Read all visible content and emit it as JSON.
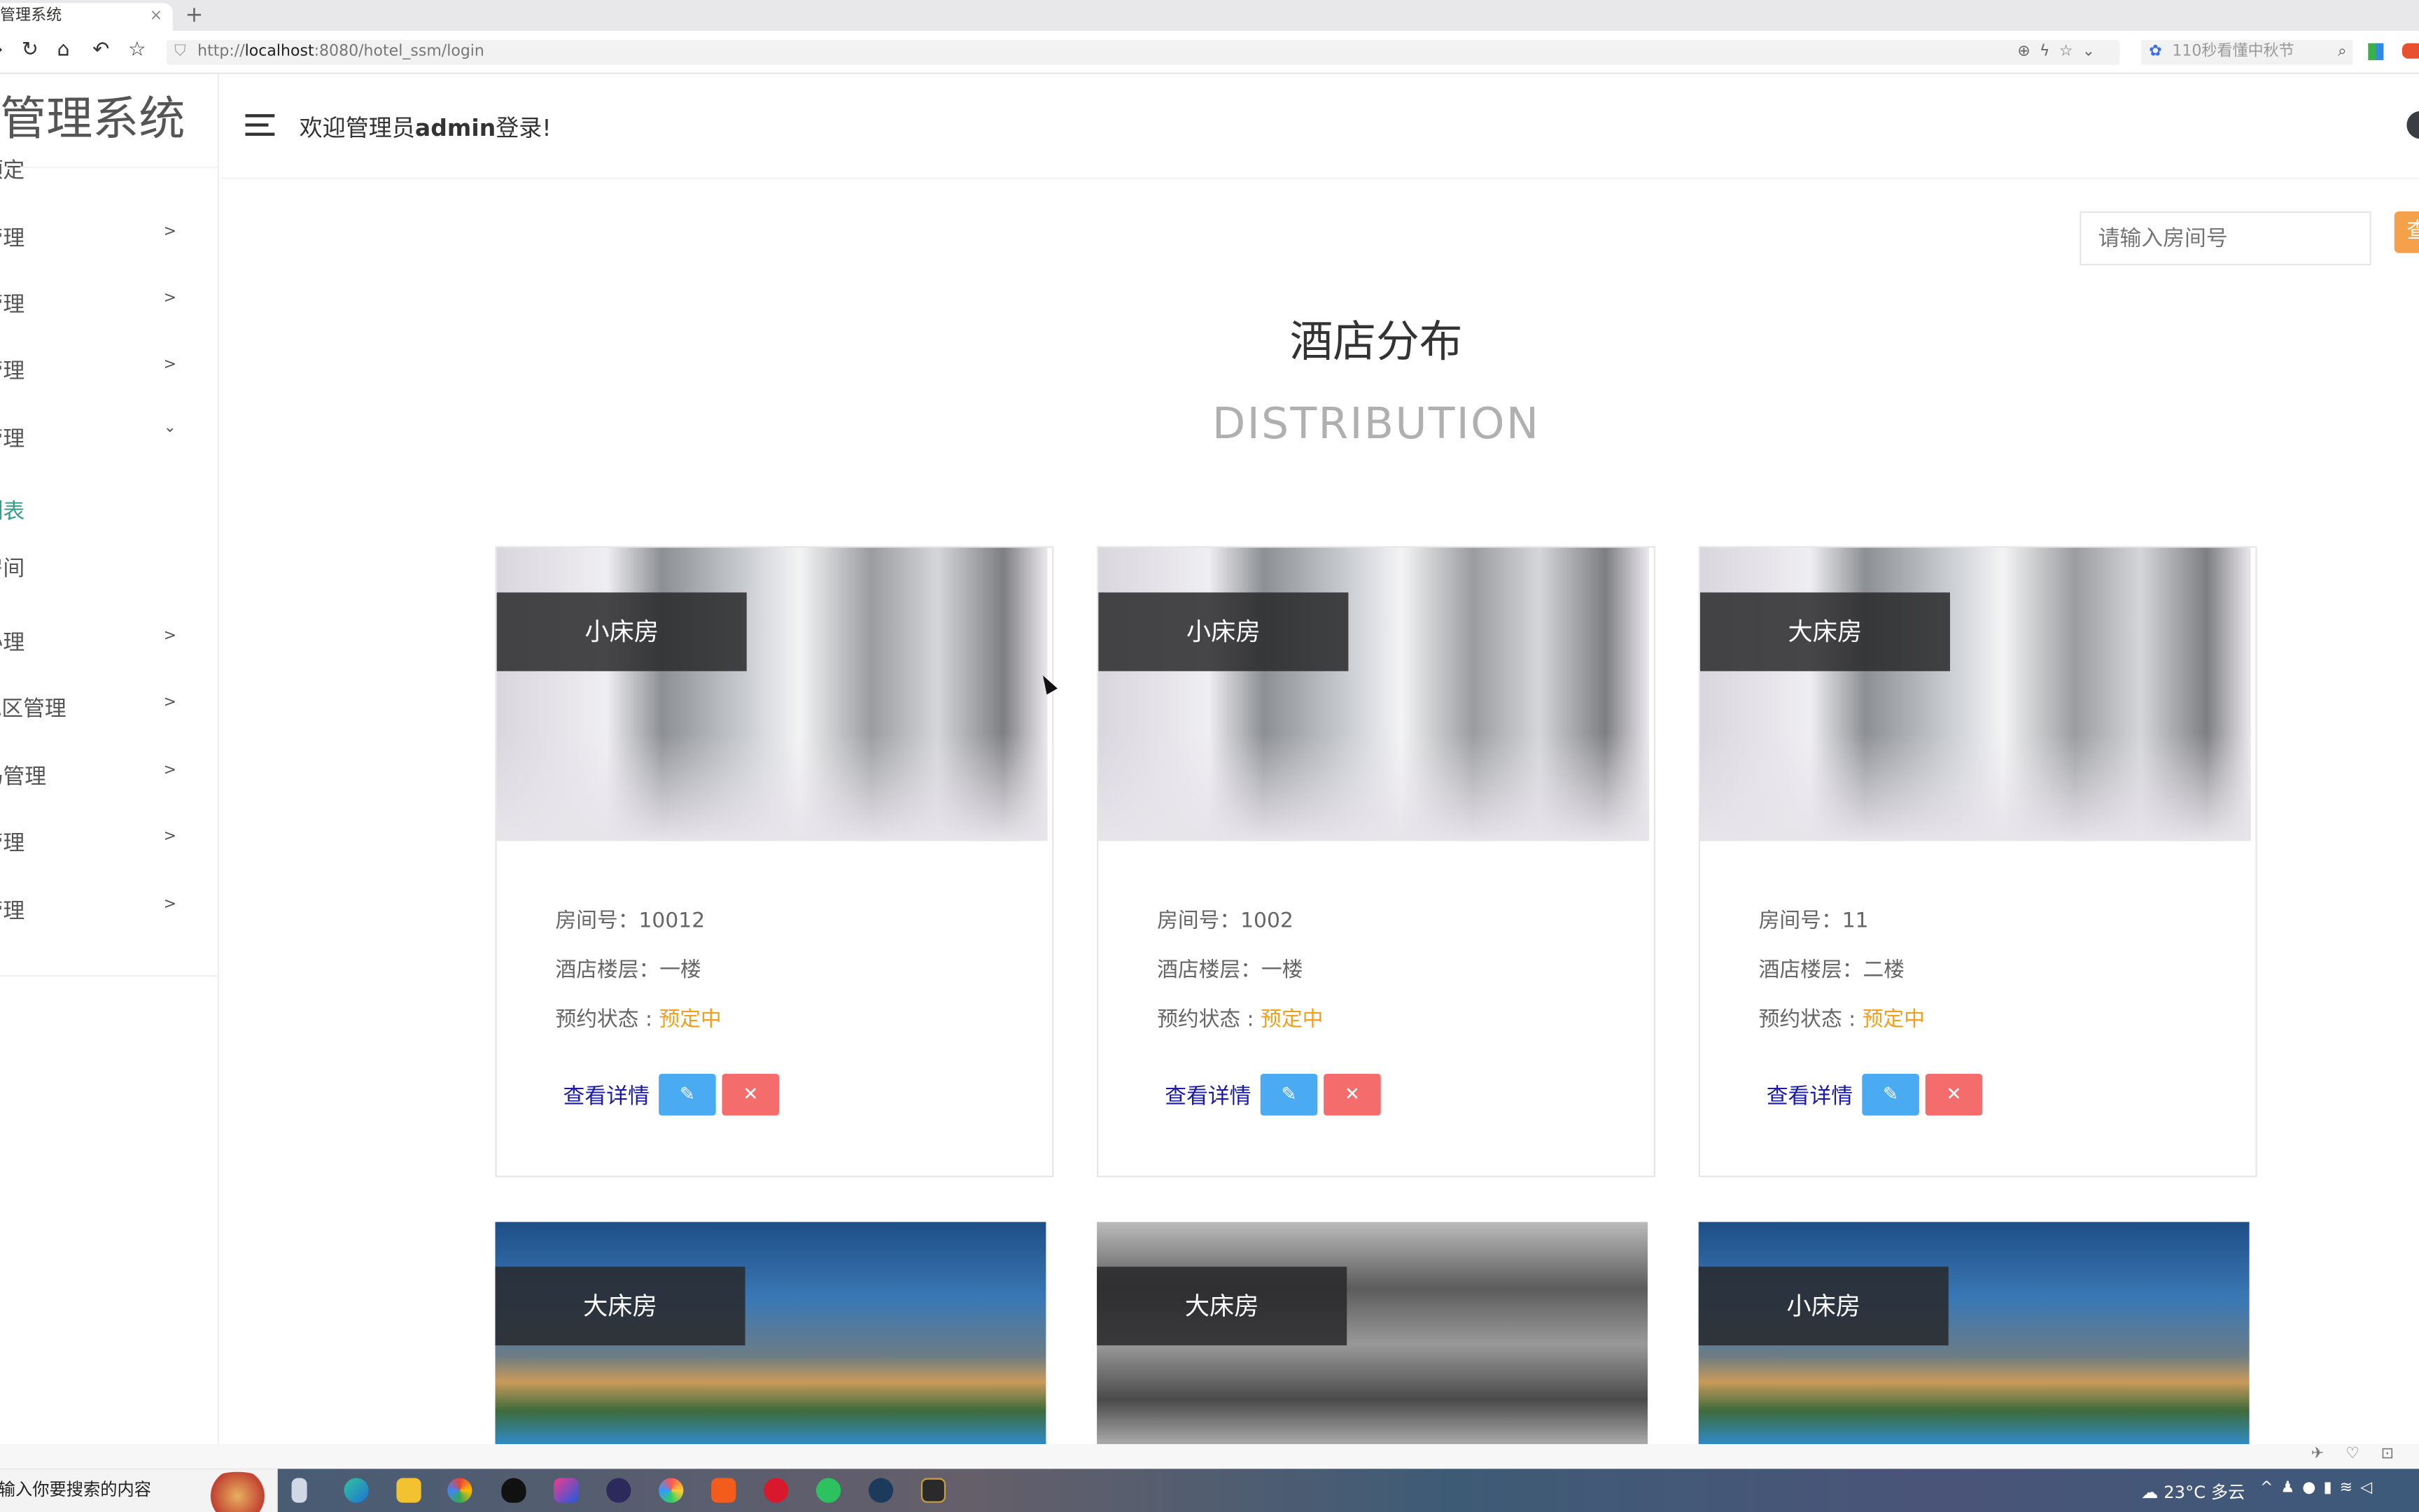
{
  "browser": {
    "tab_title": "管理系统",
    "tab_close": "×",
    "new_tab": "+",
    "url_prefix": "http://",
    "url_host": "localhost",
    "url_rest": ":8080/hotel_ssm/login",
    "search_hint": "110秒看懂中秋节"
  },
  "sidebar": {
    "title": "管理系统",
    "items": [
      {
        "label": "预定",
        "chevron": ""
      },
      {
        "label": "管理",
        "chevron": ">"
      },
      {
        "label": "管理",
        "chevron": ">"
      },
      {
        "label": "管理",
        "chevron": ">"
      },
      {
        "label": "管理",
        "chevron": "⌄"
      },
      {
        "label": "列表",
        "chevron": ""
      },
      {
        "label": "房间",
        "chevron": ""
      },
      {
        "label": "办理",
        "chevron": ">"
      },
      {
        "label": "地区管理",
        "chevron": ">"
      },
      {
        "label": "码管理",
        "chevron": ">"
      },
      {
        "label": "管理",
        "chevron": ">"
      },
      {
        "label": "管理",
        "chevron": ">"
      }
    ]
  },
  "header": {
    "welcome_prefix": "欢迎管理员",
    "welcome_user": "admin",
    "welcome_suffix": "登录!"
  },
  "search": {
    "placeholder": "请输入房间号",
    "button_label": "查"
  },
  "main": {
    "title": "酒店分布",
    "subtitle": "DISTRIBUTION"
  },
  "labels": {
    "room_no": "房间号：",
    "floor": "酒店楼层：",
    "status": "预约状态 : ",
    "detail": "查看详情",
    "edit_icon": "✎",
    "delete_icon": "✕"
  },
  "cards": [
    {
      "type": "小床房",
      "room_no": "10012",
      "floor": "一楼",
      "status": "预定中"
    },
    {
      "type": "小床房",
      "room_no": "1002",
      "floor": "一楼",
      "status": "预定中"
    },
    {
      "type": "大床房",
      "room_no": "11",
      "floor": "二楼",
      "status": "预定中"
    },
    {
      "type": "大床房"
    },
    {
      "type": "大床房"
    },
    {
      "type": "小床房"
    }
  ],
  "taskbar": {
    "search_placeholder": "请输入你要搜索的内容",
    "weather": "23°C 多云"
  },
  "colors": {
    "edit": "#4aabf3",
    "delete": "#f56c6c",
    "status": "#f0a020",
    "link": "#1a1aa6",
    "active_menu": "#3a9c8c",
    "search_button": "#f5a04a"
  }
}
